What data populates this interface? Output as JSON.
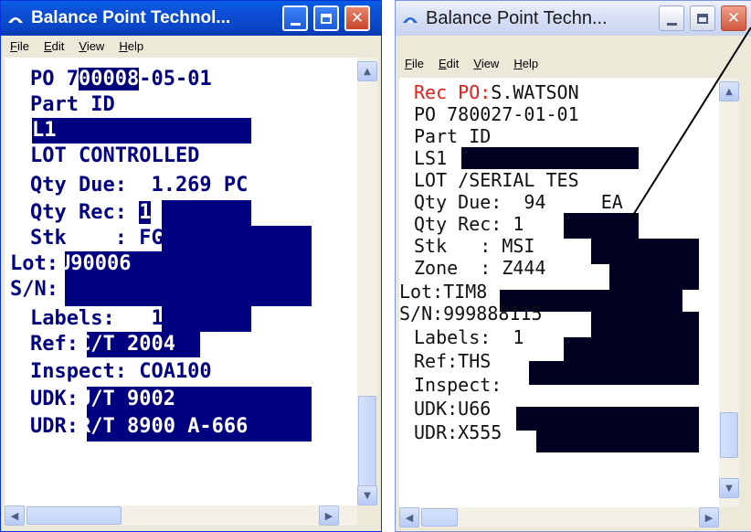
{
  "left_window": {
    "title": "Balance Point Technol...",
    "menu": [
      "File",
      "Edit",
      "View",
      "Help"
    ],
    "lines": {
      "po_prefix": "PO 7",
      "po_field": "00008",
      "po_suffix": "-05-01",
      "part_id_label": "Part ID",
      "part_id_value": "L1",
      "lot_controlled": "LOT CONTROLLED",
      "qty_due": "Qty Due:  1.269 PC",
      "qty_rec_label": "Qty Rec: ",
      "qty_rec_value": "1",
      "stk": "Stk    : FGI",
      "lot_label": "Lot:",
      "lot_value": "U90006",
      "sn_label": "S/N:",
      "labels_label": "Labels:",
      "labels_value": "1",
      "ref_label": "Ref:",
      "ref_value": "C/T 2004",
      "inspect": "Inspect: COA100",
      "udk_label": "UDK:",
      "udk_value": "U/T 9002",
      "udr_label": "UDR:",
      "udr_value": "R/T 8900 A-666"
    }
  },
  "right_window": {
    "title": "Balance Point Techn...",
    "menu": [
      "File",
      "Edit",
      "View",
      "Help"
    ],
    "lines": {
      "rec_po_label": "Rec PO:",
      "rec_po_value": "S.WATSON",
      "po": "PO 780027-01-01",
      "part_id_label": "Part ID",
      "part_id_value": "LS1",
      "lot_serial": "LOT /SERIAL TES",
      "qty_due": "Qty Due:  94     EA",
      "qty_rec": "Qty Rec: 1",
      "stk": "Stk   : MSI",
      "zone": "Zone  : Z444",
      "lot": "Lot:TIM8",
      "sn": "S/N:999888115",
      "labels": "Labels:  1",
      "ref": "Ref:THS",
      "inspect": "Inspect:",
      "udk": "UDK:U66",
      "udr": "UDR:X555"
    }
  },
  "colors": {
    "left_accent": "#000080",
    "right_label_red": "#e02020",
    "right_block": "#000020"
  }
}
